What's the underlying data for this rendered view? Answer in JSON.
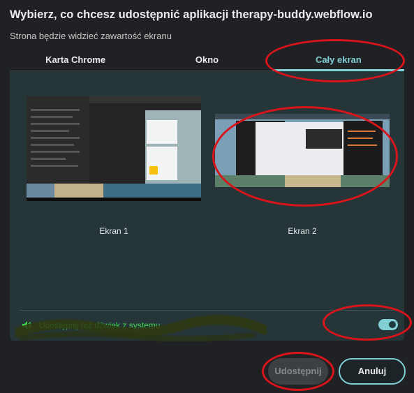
{
  "dialog": {
    "title": "Wybierz, co chcesz udostępnić aplikacji therapy-buddy.webflow.io",
    "subtitle": "Strona będzie widzieć zawartość ekranu"
  },
  "tabs": [
    {
      "label": "Karta Chrome"
    },
    {
      "label": "Okno"
    },
    {
      "label": "Cały ekran"
    }
  ],
  "screens": [
    {
      "label": "Ekran 1"
    },
    {
      "label": "Ekran 2"
    }
  ],
  "audio": {
    "label": "Udostępnij też dźwięk z systemu",
    "icon": "speaker-icon"
  },
  "buttons": {
    "share": "Udostępnij",
    "cancel": "Anuluj"
  },
  "colors": {
    "accent": "#7fcfd4",
    "audio_text": "#3fd94f",
    "annotation": "#d9141a"
  }
}
